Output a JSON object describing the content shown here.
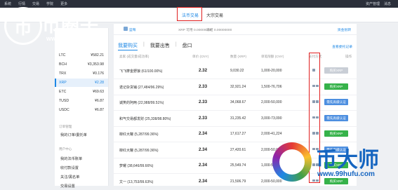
{
  "topnav": {
    "items": [
      "系统",
      "行情",
      "交易",
      "学院",
      "更多"
    ],
    "right_items": [
      "资产管理",
      "消息"
    ]
  },
  "subtabs": [
    "法币交易",
    "大宗交易"
  ],
  "sidebar": {
    "coins": [
      {
        "name": "LTC",
        "price": "¥582.21"
      },
      {
        "name": "BCH",
        "price": "¥3,353.98"
      },
      {
        "name": "TRX",
        "price": "¥0.176"
      },
      {
        "name": "XRP",
        "price": "¥2.28"
      },
      {
        "name": "ETC",
        "price": "¥69.63"
      },
      {
        "name": "TUSD",
        "price": "¥6.87"
      },
      {
        "name": "USDC",
        "price": "¥6.87"
      }
    ],
    "section_orders": "订单管理",
    "links_orders": [
      "我的订单/委托单"
    ],
    "section_user": "用户中心",
    "links_user": [
      "我的法币账单",
      "收付款设置",
      "关注/黑名单",
      "交易设置"
    ]
  },
  "user": {
    "name": "蓝莓",
    "balance_label_1": "XRP 可用 0.00000000",
    "balance_label_2": "冻结 0.00000000",
    "transfer_link": "资金划转"
  },
  "trade_tabs": {
    "buy": "我要购买",
    "sell": "我要出售",
    "pending": "盘口"
  },
  "record_link": "查看委托记录",
  "table": {
    "headers": [
      "卖家 (成交量/成功率)",
      "单价 (CNY)",
      "数量 (XRP)",
      "单笔限额 (CNY)",
      "支付方式",
      "操作"
    ],
    "rows": [
      {
        "seller": "飞飞摩金野狼 (61/100.00%)",
        "price": "2.32",
        "qty": "9,030.22",
        "limit": "1,000-20,000",
        "pay_methods": 1,
        "action": "购买XRP",
        "action_style": "grey"
      },
      {
        "seller": "诺记杂货铺 (27,484/96.29%)",
        "price": "2.33",
        "qty": "32,921.24",
        "limit": "1,500-76,706",
        "pay_methods": 2,
        "action": "购买XRP",
        "action_style": "green"
      },
      {
        "seller": "诚笑的阿两 (22,988/99.51%)",
        "price": "2.33",
        "qty": "34,068.67",
        "limit": "2,000-50,000",
        "pay_methods": 2,
        "action": "需先高级认证",
        "action_style": "blue"
      },
      {
        "seller": "和气交易都发财 (25,338/98.80%)",
        "price": "2.33",
        "qty": "31,235.42",
        "limit": "3,000-73,090",
        "pay_methods": 2,
        "action": "需先高级认证",
        "action_style": "blue"
      },
      {
        "seller": "柳红大罐 (5,287/99.36%)",
        "price": "2.34",
        "qty": "17,617.27",
        "limit": "2,000-41,224",
        "pay_methods": 2,
        "action": "购买XRP",
        "action_style": "green"
      },
      {
        "seller": "柳红大罐 (5,287/99.36%)",
        "price": "2.34",
        "qty": "27,420.61",
        "limit": "2,000-50,000",
        "pay_methods": 2,
        "action": "需先高级认证",
        "action_style": "blue"
      },
      {
        "seller": "梦耀 (38,646/99.66%)",
        "price": "2.34",
        "qty": "25,549.74",
        "limit": "1,000-50,000",
        "pay_methods": 2,
        "action": "购买XRP",
        "action_style": "green"
      },
      {
        "seller": "文一 (13,753/99.63%)",
        "price": "2.34",
        "qty": "21,506.79",
        "limit": "2,000-50,000",
        "pay_methods": 2,
        "action": "购买XRP",
        "action_style": "green"
      }
    ]
  },
  "watermarks": {
    "left_mark": "币",
    "left_text": "币圈子",
    "left_url": "www.120btc.com",
    "right_text": "币大师",
    "right_url": "www.99hufu.com"
  },
  "colors": {
    "accent": "#1e88e5",
    "buy_green": "#36b24a",
    "verify_blue": "#4d8fe0",
    "highlight_red": "#e02020"
  }
}
